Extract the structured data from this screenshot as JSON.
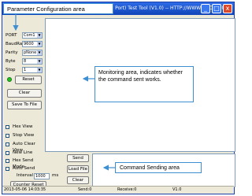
{
  "window": {
    "title": "SA   (  all Port) Test Tool (V1.0) -- HTTP://WWW.SL.COM.CN",
    "title_left_char": "S",
    "min_label": "_",
    "max_label": "□",
    "close_label": "x"
  },
  "params": {
    "port": {
      "label": "PORT",
      "value": "Com1"
    },
    "baud": {
      "label": "BaudRat",
      "value": "9600"
    },
    "parity": {
      "label": "Parity",
      "value": "pNone"
    },
    "byte": {
      "label": "Byte",
      "value": "8"
    },
    "stop": {
      "label": "Stop",
      "value": "1"
    }
  },
  "buttons": {
    "reset": "Reset",
    "clear": "Clear",
    "save_to_file": "Save To File",
    "send": "Send",
    "load_file": "Load File",
    "counter_reset": "Counter Reset",
    "clear2": "Clear"
  },
  "checkboxes": {
    "hex_view": "Hex View",
    "stop_view": "Stop View",
    "auto_clear_view": "Auto Clear View",
    "new_line": "New Line",
    "hex_send_mode": "Hex Send Mode",
    "auto_send": "Auto Send"
  },
  "interval": {
    "label": "Interval",
    "value": "1000",
    "unit": "ms"
  },
  "status": {
    "datetime": "2013-05-06 14:03:35",
    "send": "Send:0",
    "receive": "Receive:0",
    "version": "V1.0"
  },
  "annotations": {
    "param_area": "Parameter Configuration area",
    "monitor_area": "Monitoring area, indicates whether the command sent works.",
    "send_area": "Command Sending area"
  },
  "colors": {
    "titlebar": "#0f44b8",
    "callout_border": "#3d8fd1",
    "led": "#22c322"
  }
}
